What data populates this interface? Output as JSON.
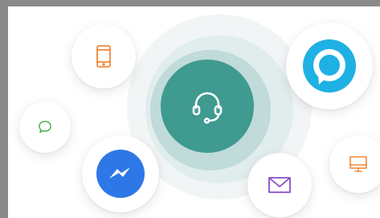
{
  "icons": {
    "phone": "phone-icon",
    "chat": "chat-bubble-icon",
    "messenger": "messenger-icon",
    "support": "headset-icon",
    "email": "envelope-icon",
    "alexa": "alexa-icon",
    "desktop": "desktop-icon"
  },
  "colors": {
    "phone": "#f0883a",
    "chat": "#4caf50",
    "messenger": "#2d78e6",
    "support": "#3f9a90",
    "email": "#8a4fc8",
    "alexa": "#1fb1e3",
    "desktop": "#f0883a"
  }
}
